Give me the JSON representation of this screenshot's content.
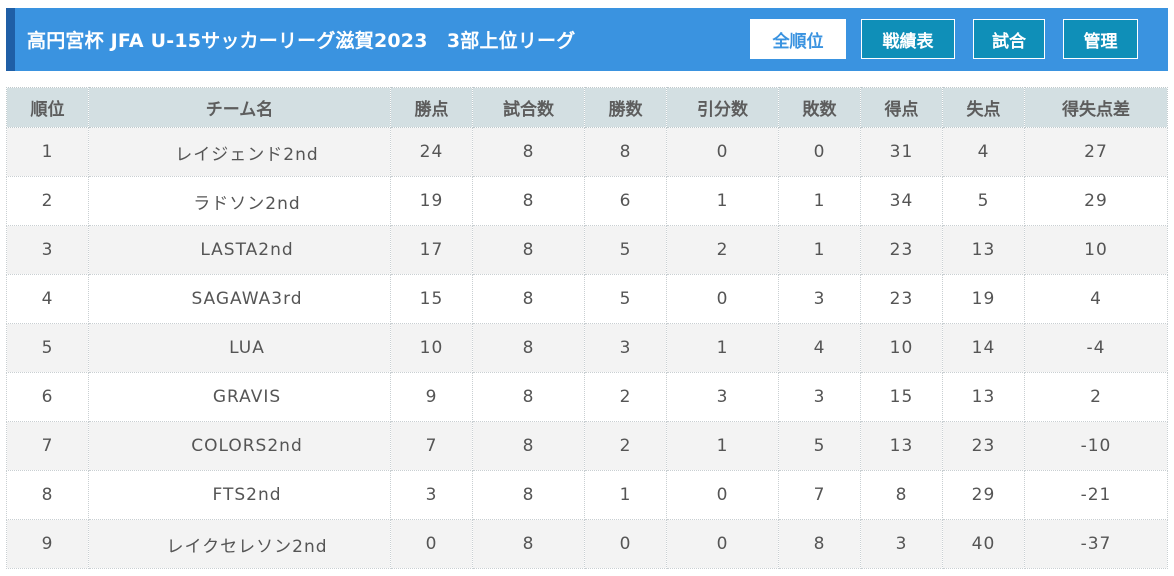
{
  "header": {
    "title": "高円宮杯 JFA U-15サッカーリーグ滋賀2023　3部上位リーグ",
    "nav": [
      {
        "label": "全順位",
        "active": true
      },
      {
        "label": "戦績表",
        "active": false
      },
      {
        "label": "試合",
        "active": false
      },
      {
        "label": "管理",
        "active": false
      }
    ]
  },
  "table": {
    "columns": [
      "順位",
      "チーム名",
      "勝点",
      "試合数",
      "勝数",
      "引分数",
      "敗数",
      "得点",
      "失点",
      "得失点差"
    ],
    "rows": [
      [
        "1",
        "レイジェンド2nd",
        "24",
        "8",
        "8",
        "0",
        "0",
        "31",
        "4",
        "27"
      ],
      [
        "2",
        "ラドソン2nd",
        "19",
        "8",
        "6",
        "1",
        "1",
        "34",
        "5",
        "29"
      ],
      [
        "3",
        "LASTA2nd",
        "17",
        "8",
        "5",
        "2",
        "1",
        "23",
        "13",
        "10"
      ],
      [
        "4",
        "SAGAWA3rd",
        "15",
        "8",
        "5",
        "0",
        "3",
        "23",
        "19",
        "4"
      ],
      [
        "5",
        "LUA",
        "10",
        "8",
        "3",
        "1",
        "4",
        "10",
        "14",
        "-4"
      ],
      [
        "6",
        "GRAVIS",
        "9",
        "8",
        "2",
        "3",
        "3",
        "15",
        "13",
        "2"
      ],
      [
        "7",
        "COLORS2nd",
        "7",
        "8",
        "2",
        "1",
        "5",
        "13",
        "23",
        "-10"
      ],
      [
        "8",
        "FTS2nd",
        "3",
        "8",
        "1",
        "0",
        "7",
        "8",
        "29",
        "-21"
      ],
      [
        "9",
        "レイクセレソン2nd",
        "0",
        "8",
        "0",
        "0",
        "8",
        "3",
        "40",
        "-37"
      ]
    ]
  },
  "colors": {
    "header_bg": "#3a93e0",
    "header_accent": "#1f5fa6",
    "nav_button_bg": "#0f8fb8",
    "table_header_bg": "#d3dfe2",
    "row_alt_bg": "#f3f3f3"
  }
}
